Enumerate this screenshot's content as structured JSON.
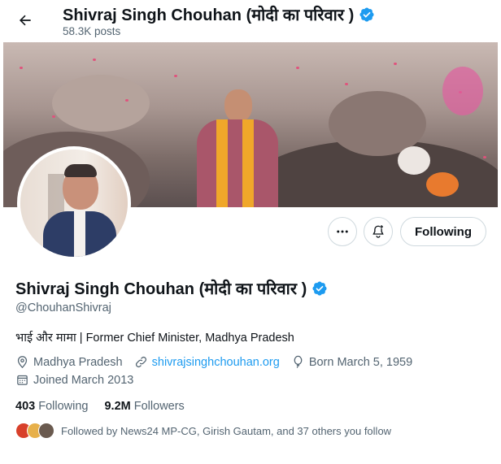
{
  "header": {
    "title": "Shivraj Singh Chouhan (मोदी का परिवार )",
    "posts_count": "58.3K posts",
    "back_icon": "arrow-left-icon"
  },
  "profile": {
    "name": "Shivraj Singh Chouhan (मोदी का परिवार )",
    "handle": "@ChouhanShivraj",
    "bio": "भाई और मामा | Former Chief Minister, Madhya Pradesh",
    "location": "Madhya Pradesh",
    "website": "shivrajsinghchouhan.org",
    "born": "Born March 5, 1959",
    "joined": "Joined March 2013",
    "verified_color": "#1d9bf0"
  },
  "actions": {
    "following_label": "Following"
  },
  "stats": {
    "following_count": "403",
    "following_label": "Following",
    "followers_count": "9.2M",
    "followers_label": "Followers"
  },
  "followed_by": {
    "text": "Followed by News24 MP-CG, Girish Gautam, and 37 others you follow"
  }
}
